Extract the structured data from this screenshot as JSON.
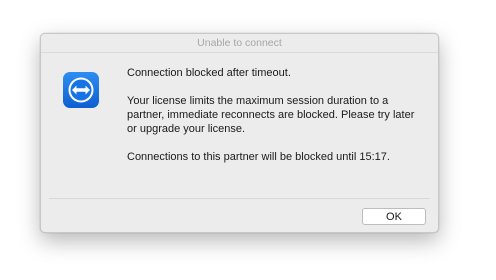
{
  "dialog": {
    "title": "Unable to connect",
    "icon": "teamviewer-app-icon",
    "heading": "Connection blocked after timeout.",
    "message": "Your license limits the maximum session duration to a partner, immediate reconnects are blocked. Please try later or upgrade your license.",
    "footer_message": "Connections to this partner will be blocked until 15:17.",
    "ok_label": "OK"
  },
  "colors": {
    "icon_blue": "#1673e6",
    "dialog_bg": "#ececec",
    "title_text": "#a6a6a6"
  }
}
